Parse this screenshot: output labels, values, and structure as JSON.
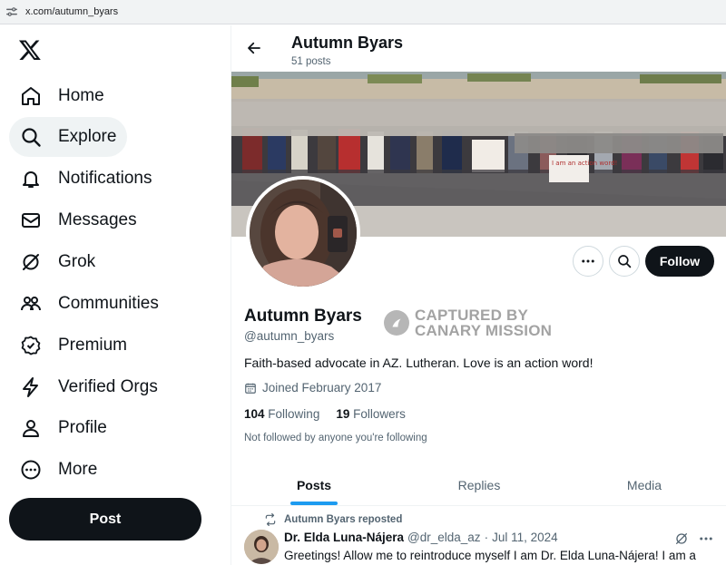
{
  "browser": {
    "url": "x.com/autumn_byars"
  },
  "sidebar": {
    "items": [
      {
        "label": "Home",
        "icon": "home-icon"
      },
      {
        "label": "Explore",
        "icon": "search-icon",
        "active": true
      },
      {
        "label": "Notifications",
        "icon": "bell-icon"
      },
      {
        "label": "Messages",
        "icon": "envelope-icon"
      },
      {
        "label": "Grok",
        "icon": "grok-icon"
      },
      {
        "label": "Communities",
        "icon": "people-icon"
      },
      {
        "label": "Premium",
        "icon": "verified-badge-icon"
      },
      {
        "label": "Verified Orgs",
        "icon": "lightning-icon"
      },
      {
        "label": "Profile",
        "icon": "person-icon"
      },
      {
        "label": "More",
        "icon": "more-circle-icon"
      }
    ],
    "post_label": "Post"
  },
  "header": {
    "name": "Autumn Byars",
    "post_count": "51 posts"
  },
  "profile": {
    "name": "Autumn Byars",
    "handle": "@autumn_byars",
    "bio": "Faith-based advocate in AZ. Lutheran.  Love is an action word!",
    "joined": "Joined February 2017",
    "following_count": "104",
    "following_label": "Following",
    "followers_count": "19",
    "followers_label": "Followers",
    "not_followed": "Not followed by anyone you're following",
    "follow_label": "Follow",
    "sign_text": "I am an action word!"
  },
  "watermark": {
    "line1": "CAPTURED BY",
    "line2": "CANARY MISSION"
  },
  "tabs": [
    {
      "label": "Posts",
      "active": true
    },
    {
      "label": "Replies"
    },
    {
      "label": "Media"
    }
  ],
  "tweet": {
    "repost_label": "Autumn Byars reposted",
    "author": "Dr. Elda Luna-Nájera",
    "handle": "@dr_elda_az",
    "separator": "·",
    "date": "Jul 11, 2024",
    "text": "Greetings! Allow me to reintroduce myself I am Dr. Elda Luna-Nájera! I am a"
  },
  "colors": {
    "accent": "#1d9bf0",
    "text": "#0f1419",
    "muted": "#536471",
    "button_dark": "#0f1419"
  }
}
